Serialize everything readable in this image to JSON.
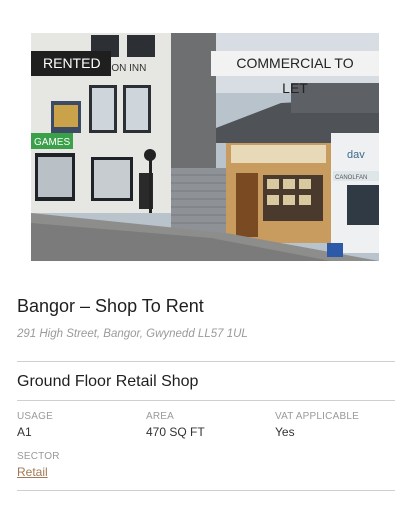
{
  "listing": {
    "status_badge": "RENTED",
    "type_badge": "COMMERCIAL TO LET",
    "title": "Bangor – Shop To Rent",
    "address": "291 High Street, Bangor, Gwynedd LL57 1UL",
    "subtitle": "Ground Floor Retail Shop"
  },
  "details": {
    "usage": {
      "label": "USAGE",
      "value": "A1"
    },
    "area": {
      "label": "AREA",
      "value": "470 SQ FT"
    },
    "vat": {
      "label": "VAT APPLICABLE",
      "value": "Yes"
    },
    "sector": {
      "label": "SECTOR",
      "value": "Retail"
    }
  },
  "photo": {
    "signs": [
      "LION INN",
      "GAMES",
      "CANOLFAN",
      "dav"
    ]
  }
}
